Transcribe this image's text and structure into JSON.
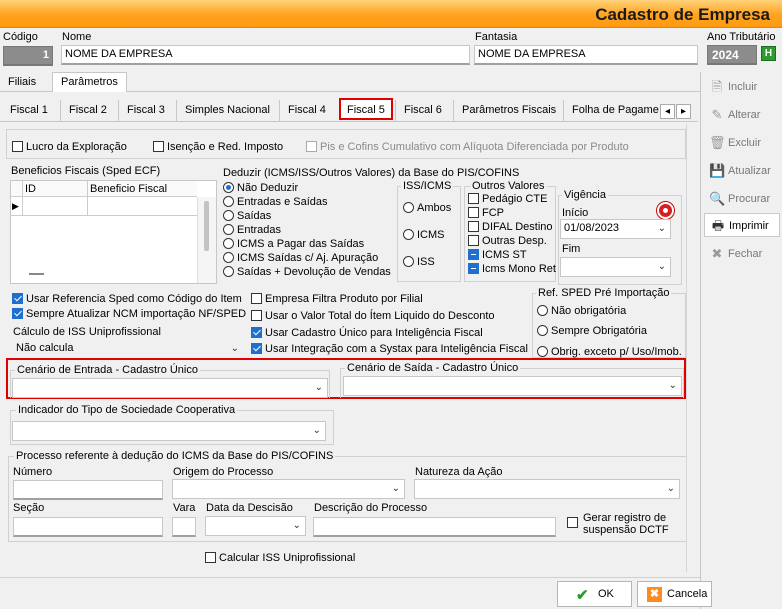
{
  "window_title": "Cadastro de Empresa",
  "top": {
    "codigo_label": "Código",
    "codigo_value": "1",
    "nome_label": "Nome",
    "nome_value": "NOME DA EMPRESA",
    "fantasia_label": "Fantasia",
    "fantasia_value": "NOME DA EMPRESA",
    "ano_label": "Ano Tributário",
    "ano_value": "2024",
    "help_label": "H"
  },
  "outer_tabs": [
    "Filiais",
    "Parâmetros"
  ],
  "inner_tabs": [
    "Fiscal 1",
    "Fiscal 2",
    "Fiscal 3",
    "Simples Nacional",
    "Fiscal 4",
    "Fiscal 5",
    "Fiscal 6",
    "Parâmetros Fiscais",
    "Folha de Pagamen"
  ],
  "scroll_arrows": {
    "left": "◂",
    "right": "▸"
  },
  "row1": {
    "lucro": "Lucro da Exploração",
    "isencao": "Isenção e Red. Imposto",
    "pis_cofins": "Pis e Cofins Cumulativo com Alíquota Diferenciada por Produto"
  },
  "beneficios": {
    "title": "Beneficios Fiscais (Sped ECF)",
    "col_id": "ID",
    "col_beneficio": "Beneficio Fiscal",
    "row_marker": "▶"
  },
  "deduzir": {
    "title": "Deduzir (ICMS/ISS/Outros Valores)  da Base do PIS/COFINS",
    "options": [
      "Não Deduzir",
      "Entradas e Saídas",
      "Saídas",
      "Entradas",
      "ICMS a Pagar das Saídas",
      "ICMS Saídas c/ Aj. Apuração",
      "Saídas +  Devolução de Vendas"
    ],
    "iss_icms_title": "ISS/ICMS",
    "iss_icms_options": [
      "Ambos",
      "ICMS",
      "ISS"
    ],
    "outros_title": "Outros Valores",
    "outros_options": [
      "Pedágio CTE",
      "FCP",
      "DIFAL Destino",
      "Outras Desp.",
      "ICMS ST",
      "Icms Mono Ret"
    ]
  },
  "vigencia": {
    "title": "Vigência",
    "inicio_label": "Início",
    "inicio_value": "01/08/2023",
    "fim_label": "Fim",
    "fim_value": ""
  },
  "checks_left": {
    "usar_ref": "Usar Referencia Sped como Código do Item",
    "sempre_ncm": "Sempre Atualizar NCM importação NF/SPED",
    "calc_iss_label": "Cálculo de ISS Uniprofissional",
    "calc_iss_value": "Não calcula"
  },
  "checks_mid": {
    "filtra": "Empresa Filtra Produto por Filial",
    "valor_total": "Usar o Valor Total do Ítem Liquido do Desconto",
    "cadastro_unico": "Usar Cadastro Único para Inteligência Fiscal",
    "integracao": "Usar Integração com a Systax para Inteligência Fiscal"
  },
  "ref_sped": {
    "title": "Ref. SPED Pré Importação",
    "options": [
      "Não obrigatória",
      "Sempre Obrigatória",
      "Obrig. exceto p/ Uso/Imob."
    ]
  },
  "cenario": {
    "entrada": "Cenário de Entrada - Cadastro Único",
    "saida": "Cenário de Saída - Cadastro Único"
  },
  "cooperativa": {
    "title": "Indicador do Tipo de Sociedade Cooperativa"
  },
  "processo": {
    "title": "Processo referente à dedução do ICMS da Base do PIS/COFINS",
    "numero": "Número",
    "origem": "Origem do Processo",
    "natureza": "Natureza da Ação",
    "secao": "Seção",
    "vara": "Vara",
    "data": "Data da Descisão",
    "descricao": "Descrição do Processo",
    "gerar": "Gerar registro de suspensão DCTF"
  },
  "calcular_iss": "Calcular ISS Uniprofissional",
  "sidebar": [
    "Incluir",
    "Alterar",
    "Excluir",
    "Atualizar",
    "Procurar",
    "Imprimir",
    "Fechar"
  ],
  "buttons": {
    "ok": "OK",
    "cancel": "Cancela"
  },
  "colors": {
    "accent": "#ffa21e",
    "highlight": "#e00000",
    "check": "#1e6fd0"
  }
}
